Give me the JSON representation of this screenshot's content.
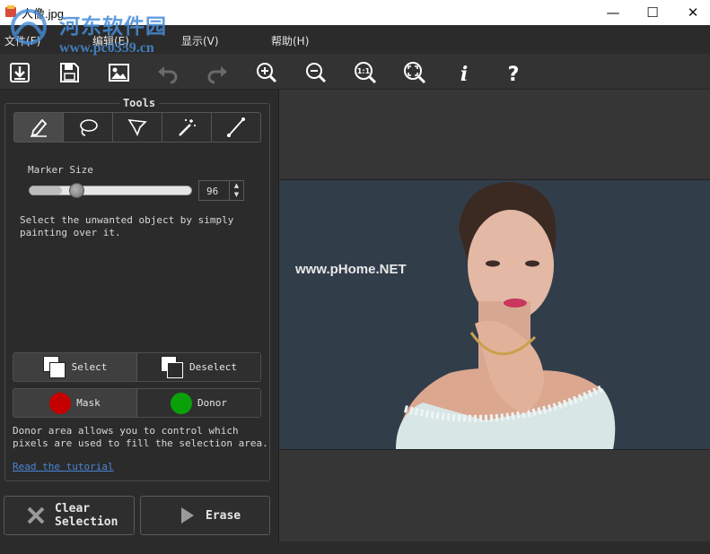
{
  "window": {
    "title": "人像.jpg",
    "minimize": "—",
    "maximize": "☐",
    "close": "✕"
  },
  "watermark": {
    "site_name": "河东软件园",
    "site_url": "www.pc0359.cn"
  },
  "menu": {
    "items": [
      {
        "label": "文件(F)"
      },
      {
        "label": "编辑(E)"
      },
      {
        "label": "显示(V)"
      },
      {
        "label": "帮助(H)"
      }
    ]
  },
  "toolbar": {
    "buttons": [
      {
        "icon": "import-icon"
      },
      {
        "icon": "save-icon"
      },
      {
        "icon": "image-icon"
      },
      {
        "icon": "undo-icon"
      },
      {
        "icon": "redo-icon"
      },
      {
        "icon": "zoom-in-icon"
      },
      {
        "icon": "zoom-out-icon"
      },
      {
        "icon": "zoom-actual-icon",
        "text": "1:1"
      },
      {
        "icon": "zoom-fit-icon"
      },
      {
        "icon": "info-icon",
        "text": "i"
      },
      {
        "icon": "help-icon",
        "text": "?"
      }
    ]
  },
  "tools": {
    "title": "Tools",
    "buttons": [
      {
        "icon": "marker-icon",
        "active": true
      },
      {
        "icon": "lasso-icon"
      },
      {
        "icon": "polygon-lasso-icon"
      },
      {
        "icon": "magic-wand-icon"
      },
      {
        "icon": "line-icon"
      }
    ],
    "marker_size_label": "Marker Size",
    "marker_size_value": "96",
    "marker_size_fraction": 0.2,
    "instructions": "Select the unwanted object by simply painting over it."
  },
  "selection_modes": {
    "select_label": "Select",
    "deselect_label": "Deselect"
  },
  "area_modes": {
    "mask_label": "Mask",
    "mask_color": "#c40000",
    "donor_label": "Donor",
    "donor_color": "#0aa00a"
  },
  "donor_help": "Donor area allows you to control which pixels are used to fill the selection area.",
  "tutorial_link": "Read the tutorial",
  "actions": {
    "clear_label": "Clear\nSelection",
    "erase_label": "Erase"
  },
  "canvas": {
    "image_watermark": "www.pHome.NET"
  }
}
